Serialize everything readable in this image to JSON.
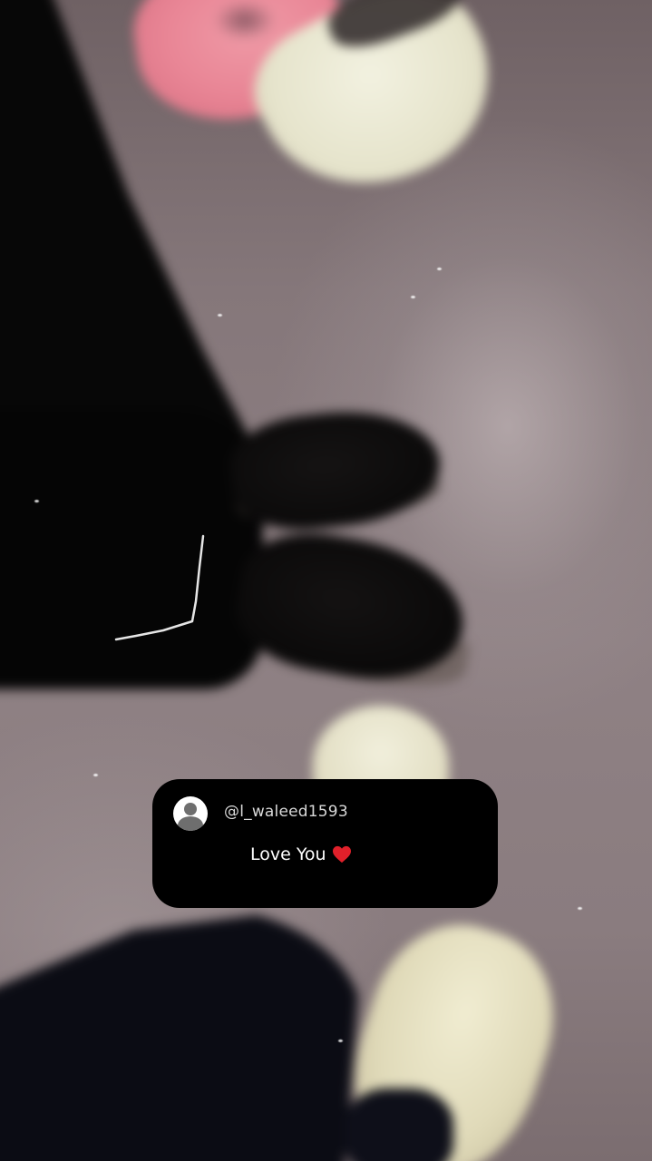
{
  "comment": {
    "username": "@l_waleed1593",
    "message": "Love You",
    "emoji": "heart-icon"
  },
  "colors": {
    "card_background": "#000000",
    "username_text": "#d9d9d9",
    "message_text": "#ffffff",
    "heart": "#e0202a",
    "floor": "#8c7e81"
  }
}
